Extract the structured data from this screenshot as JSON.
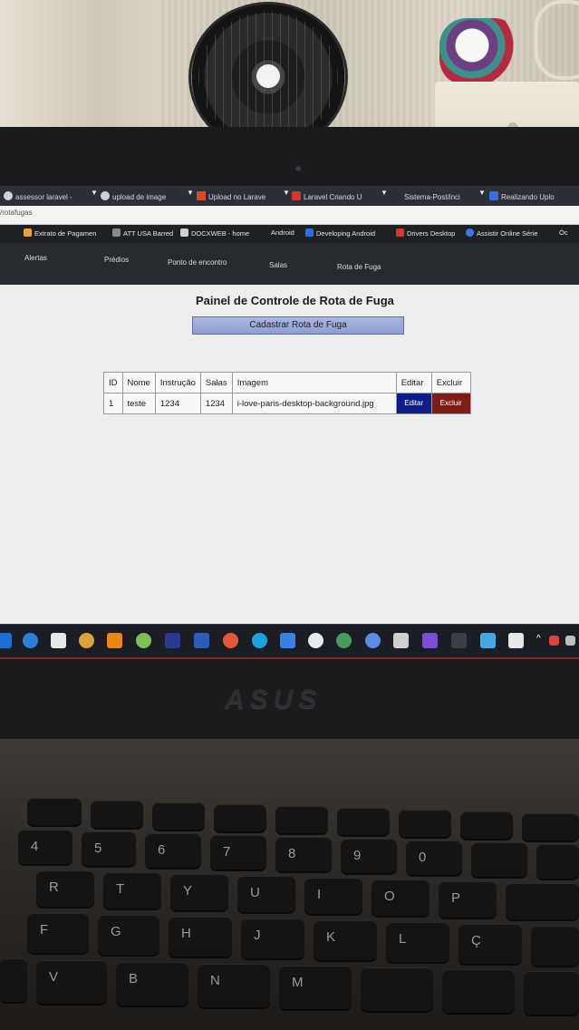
{
  "browser": {
    "tabs": [
      {
        "label": "assessor laravel -",
        "fav_color": "#cfd2d6"
      },
      {
        "label": "upload de image",
        "fav_color": "#cfd2d6"
      },
      {
        "label": "Upload no Larave",
        "fav_color": "#d64b2a"
      },
      {
        "label": "Laravel Criando U",
        "fav_color": "#d53434"
      },
      {
        "label": "Sistema-Post/inci",
        "fav_color": "#2b2f36"
      },
      {
        "label": "Realizando Uplo",
        "fav_color": "#3b6fd1"
      }
    ],
    "url": "/rotafugas",
    "bookmarks": [
      {
        "label": "Extrato de Pagamen",
        "color": "#e0a43c"
      },
      {
        "label": "ATT USA Barred",
        "color": "#888888"
      },
      {
        "label": "DOCXWEB - home",
        "color": "#cfcfcf"
      },
      {
        "label": "Android",
        "color": "#1f2024"
      },
      {
        "label": "Developing Android",
        "color": "#2e6de0"
      },
      {
        "label": "Drivers Desktop",
        "color": "#d03b2f"
      },
      {
        "label": "Assistir Online Série",
        "color": "#3a7be0"
      },
      {
        "label": "Óc",
        "color": "#cfcfcf"
      }
    ]
  },
  "nav": {
    "items": [
      "Alertas",
      "Prédios",
      "Ponto de encontro",
      "Salas",
      "Rota de Fuga"
    ]
  },
  "page": {
    "title": "Painel de Controle de Rota de Fuga",
    "create_button": "Cadastrar Rota de Fuga"
  },
  "table": {
    "headers": [
      "ID",
      "Nome",
      "Instrução",
      "Salas",
      "Imagem",
      "Editar",
      "Excluir"
    ],
    "rows": [
      {
        "id": "1",
        "nome": "teste",
        "instrucao": "1234",
        "salas": "1234",
        "imagem": "i-love-paris-desktop-background.jpg",
        "editar": "Editar",
        "excluir": "Excluir"
      }
    ]
  },
  "taskbar": {
    "icons": [
      "start",
      "edge",
      "store",
      "chrome",
      "vlc",
      "app-green",
      "photoshop",
      "app-blue",
      "app-red",
      "skype",
      "app-arrow",
      "app-circle",
      "app-globe",
      "app-disc",
      "tools",
      "visual-studio",
      "terminal",
      "app-window",
      "app-note"
    ]
  },
  "laptop": {
    "brand": "ASUS"
  },
  "keyboard": {
    "row_numbers": [
      "4",
      "5",
      "6",
      "7",
      "8",
      "9",
      "0"
    ],
    "row_top": [
      "R",
      "T",
      "Y",
      "U",
      "I",
      "O",
      "P"
    ],
    "row_home": [
      "F",
      "G",
      "H",
      "J",
      "K",
      "L",
      "Ç"
    ],
    "row_bottom": [
      "V",
      "B",
      "N",
      "M"
    ]
  },
  "colors": {
    "edit_button": "#0b1f86",
    "delete_button": "#7e1d16",
    "create_button": "#9aa8d9"
  }
}
